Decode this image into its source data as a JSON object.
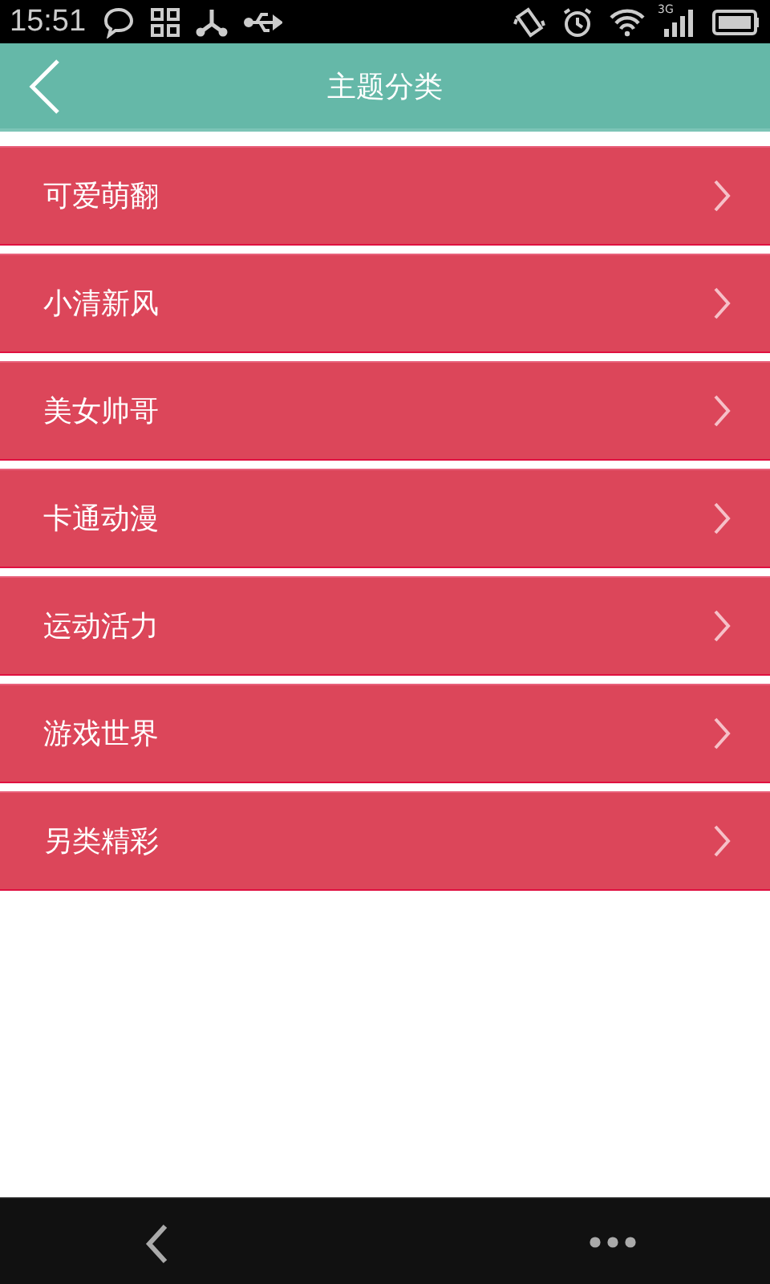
{
  "status_bar": {
    "time": "15:51",
    "network": "3G"
  },
  "app_bar": {
    "title": "主题分类"
  },
  "categories": [
    {
      "label": "可爱萌翻"
    },
    {
      "label": "小清新风"
    },
    {
      "label": "美女帅哥"
    },
    {
      "label": "卡通动漫"
    },
    {
      "label": "运动活力"
    },
    {
      "label": "游戏世界"
    },
    {
      "label": "另类精彩"
    }
  ]
}
